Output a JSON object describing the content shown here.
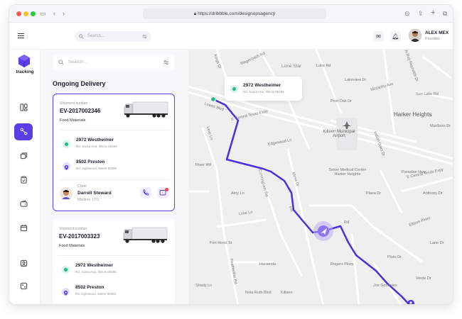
{
  "browser": {
    "url": "https://dribbble.com/designopsagency",
    "colors": {
      "close": "#ff5f57",
      "minimize": "#febc2e",
      "zoom": "#28c840"
    }
  },
  "header": {
    "search_placeholder": "Search...",
    "user": {
      "name": "ALEX MEX",
      "role": "Founder"
    }
  },
  "sidebar": {
    "brand": "tracking",
    "accent": "#5b3ee6",
    "items": [
      {
        "icon": "dashboard-icon"
      },
      {
        "icon": "route-icon",
        "active": true
      },
      {
        "icon": "box-icon"
      },
      {
        "icon": "clipboard-icon"
      },
      {
        "icon": "wallet-icon"
      },
      {
        "icon": "calendar-icon"
      },
      {
        "icon": "user-icon"
      },
      {
        "icon": "settings-icon"
      }
    ]
  },
  "panel": {
    "search_placeholder": "Search...",
    "title": "Ongoing Delivery",
    "cards": [
      {
        "shipment_label": "Shipment number",
        "shipment_number": "EV-2017002346",
        "category": "Food Materials",
        "from": {
          "title": "2972 Westheimer",
          "sub": "Rd. Santa Ana, Illinois 85486"
        },
        "to": {
          "title": "8502 Preston",
          "sub": "Rd. Inglewood, Maine 98380"
        },
        "client_label": "Client",
        "client_name": "Darrell Steward",
        "client_company": "Marlene, LTD"
      },
      {
        "shipment_label": "Shipment number",
        "shipment_number": "EV-2017003323",
        "category": "Food Materials",
        "from": {
          "title": "2972 Westheimer",
          "sub": "Rd. Santa Ana, Illinois 85486"
        },
        "to": {
          "title": "8502 Preston",
          "sub": "Rd. Inglewood, Maine 98380"
        }
      }
    ]
  },
  "map": {
    "tooltip": {
      "title": "2972 Westheimer",
      "sub": "Rd. Santa Ana, Illinois 85486"
    },
    "labels": {
      "lone_star": "Lone Star",
      "airport": "Killeen Municipal Airport",
      "harker": "Harker Heights",
      "medical": "Seton Medical Center Harker Heights",
      "central_expy": "E Central Texas Expy",
      "central_expy2": "E Central Texas Expy",
      "loves": "Lowes Blvd",
      "love_ln": "Love Ln",
      "rd": "Rd",
      "cunningham": "Cunningham Rd",
      "featherline": "Featherline Rd",
      "fm": "Fm",
      "mesa": "Mesa Dr",
      "stagecoach": "Stagecoach Rd",
      "kings": "Kings Dr",
      "levy": "Levy Ln",
      "edgewood": "Edgewood Ln",
      "ruby": "N Roy Reynolds Dr",
      "mckenzie": "Mccarthy Ave",
      "indian": "Indian Oaks Dr",
      "marlboro": "Marlboro Dr",
      "paradise": "Paradise Hwy",
      "ellison": "Ellison Pkwy",
      "sun": "Sun Lake Rd",
      "lane": "Lane Dr",
      "pluto": "Pluto Dr",
      "hacienda": "Hacienda",
      "killeen": "Killeen",
      "fort": "Fort Hood St",
      "rogers": "Rogers Pkwy",
      "shady": "Shady Ln",
      "amy": "Amy Ln",
      "post": "Post Oak Dr",
      "joe": "Joe Gonzales",
      "nola": "Nola Ruth Blvd",
      "verde": "Verde Dr",
      "lake": "Lake Rd",
      "lakeview": "Lakeview Dr",
      "river": "River Hill",
      "plaza": "Plaza Dr",
      "anthony": "Anthony Dr"
    },
    "route_color": "#4a2fe0",
    "origin_color": "#1db98a"
  }
}
